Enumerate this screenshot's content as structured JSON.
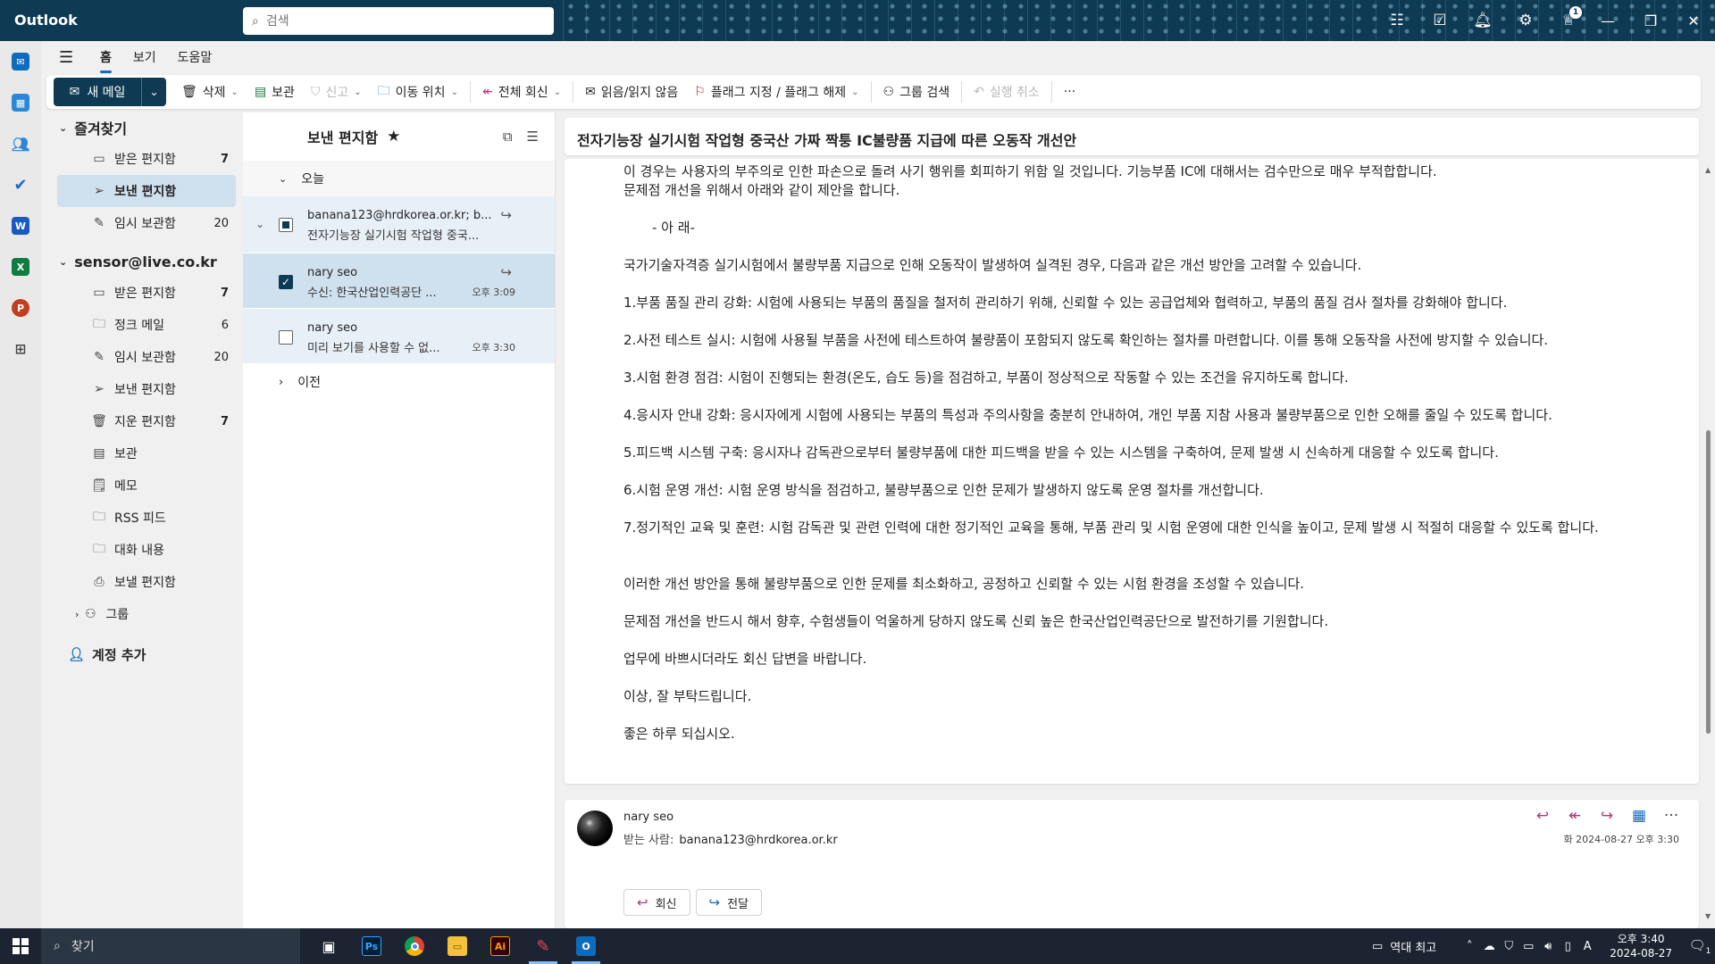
{
  "titlebar": {
    "app_name": "Outlook",
    "search_placeholder": "검색",
    "notification_badge": "1"
  },
  "menu_tabs": [
    "홈",
    "보기",
    "도움말"
  ],
  "ribbon": {
    "new_mail": "새 메일",
    "delete": "삭제",
    "archive": "보관",
    "report": "신고",
    "move_to": "이동 위치",
    "reply_all": "전체 회신",
    "read_unread": "읽음/읽지 않음",
    "flag": "플래그 지정 / 플래그 해제",
    "group_search": "그룹 검색",
    "undo": "실행 취소",
    "more": "···"
  },
  "folders": {
    "favorites_title": "즐겨찾기",
    "favorites": [
      {
        "label": "받은 편지함",
        "count": "7"
      },
      {
        "label": "보낸 편지함",
        "count": ""
      },
      {
        "label": "임시 보관함",
        "count": "20"
      }
    ],
    "account_title": "sensor@live.co.kr",
    "account": [
      {
        "label": "받은 편지함",
        "count": "7"
      },
      {
        "label": "정크 메일",
        "count": "6"
      },
      {
        "label": "임시 보관함",
        "count": "20"
      },
      {
        "label": "보낸 편지함",
        "count": ""
      },
      {
        "label": "지운 편지함",
        "count": "7"
      },
      {
        "label": "보관",
        "count": ""
      },
      {
        "label": "메모",
        "count": ""
      },
      {
        "label": "RSS 피드",
        "count": ""
      },
      {
        "label": "대화 내용",
        "count": ""
      },
      {
        "label": "보낼 편지함",
        "count": ""
      }
    ],
    "groups": "그룹",
    "add_account": "계정 추가"
  },
  "message_list": {
    "title": "보낸 편지함",
    "group_today": "오늘",
    "group_older": "이전",
    "thread": {
      "from": "banana123@hrdkorea.or.kr; b...",
      "subject": "전자기능장 실기시험 작업형 중국..."
    },
    "messages": [
      {
        "from": "nary seo",
        "subject": "수신: 한국산업인력공단 ...",
        "time": "오후 3:09"
      },
      {
        "from": "nary seo",
        "subject": "미리 보기를 사용할 수 없...",
        "time": "오후 3:30"
      }
    ]
  },
  "reading": {
    "subject": "전자기능장 실기시험 작업형 중국산 가짜 짝퉁 IC불량품 지급에 따른 오동작 개선안",
    "body": {
      "l1": "이 경우는 사용자의 부주의로 인한 파손으로 돌려 사기 행위를 회피하기 위함 일 것입니다. 기능부품 IC에 대해서는 검수만으로 매우 부적합합니다.",
      "l2": "문제점 개선을 위해서 아래와 같이 제안을 합니다.",
      "l3": "- 아 래-",
      "l4": "국가기술자격증 실기시험에서 불량부품 지급으로 인해 오동작이 발생하여 실격된 경우, 다음과 같은 개선 방안을 고려할 수 있습니다.",
      "i1": "1.부품 품질 관리 강화: 시험에 사용되는 부품의 품질을 철저히 관리하기 위해, 신뢰할 수 있는 공급업체와 협력하고, 부품의 품질 검사 절차를 강화해야 합니다.",
      "i2": "2.사전 테스트 실시: 시험에 사용될 부품을 사전에 테스트하여 불량품이 포함되지 않도록 확인하는 절차를 마련합니다. 이를 통해 오동작을 사전에 방지할 수 있습니다.",
      "i3": "3.시험 환경 점검: 시험이 진행되는 환경(온도, 습도 등)을 점검하고, 부품이 정상적으로 작동할 수 있는 조건을 유지하도록 합니다.",
      "i4": "4.응시자 안내 강화: 응시자에게 시험에 사용되는 부품의 특성과 주의사항을 충분히 안내하여, 개인 부품 지참 사용과 불량부품으로 인한 오해를 줄일 수 있도록 합니다.",
      "i5": "5.피드백 시스템 구축: 응시자나 감독관으로부터 불량부품에 대한 피드백을 받을 수 있는 시스템을 구축하여, 문제 발생 시 신속하게 대응할 수 있도록 합니다.",
      "i6": "6.시험 운영 개선: 시험 운영 방식을 점검하고, 불량부품으로 인한 문제가 발생하지 않도록 운영 절차를 개선합니다.",
      "i7": "7.정기적인 교육 및 훈련: 시험 감독관 및 관련 인력에 대한 정기적인 교육을 통해, 부품 관리 및 시험 운영에 대한 인식을 높이고, 문제 발생 시 적절히 대응할 수 있도록 합니다.",
      "c1": "이러한 개선 방안을 통해 불량부품으로 인한 문제를 최소화하고, 공정하고 신뢰할 수 있는 시험 환경을 조성할 수 있습니다.",
      "c2": "문제점 개선을 반드시 해서  향후, 수험생들이 억울하게 당하지 않도록 신뢰 높은 한국산업인력공단으로 발전하기를 기원합니다.",
      "c3": "업무에 바쁘시더라도 회신 답변을 바랍니다.",
      "c4": "이상, 잘 부탁드립니다.",
      "c5": "좋은 하루 되십시오."
    },
    "second": {
      "sender": "nary seo",
      "to_label": "받는 사람:",
      "to": "banana123@hrdkorea.or.kr",
      "date": "화 2024-08-27 오후 3:30",
      "reply": "회신",
      "forward": "전달"
    }
  },
  "taskbar": {
    "search": "찾기",
    "weather": "역대 최고",
    "time": "오후 3:40",
    "date": "2024-08-27",
    "ime": "A",
    "notif_count": "1"
  },
  "colors": {
    "titlebar": "#0f3a54",
    "accent": "#0f6cbd",
    "selected": "#cfe0ee",
    "reply_icons": "#b5367a"
  }
}
